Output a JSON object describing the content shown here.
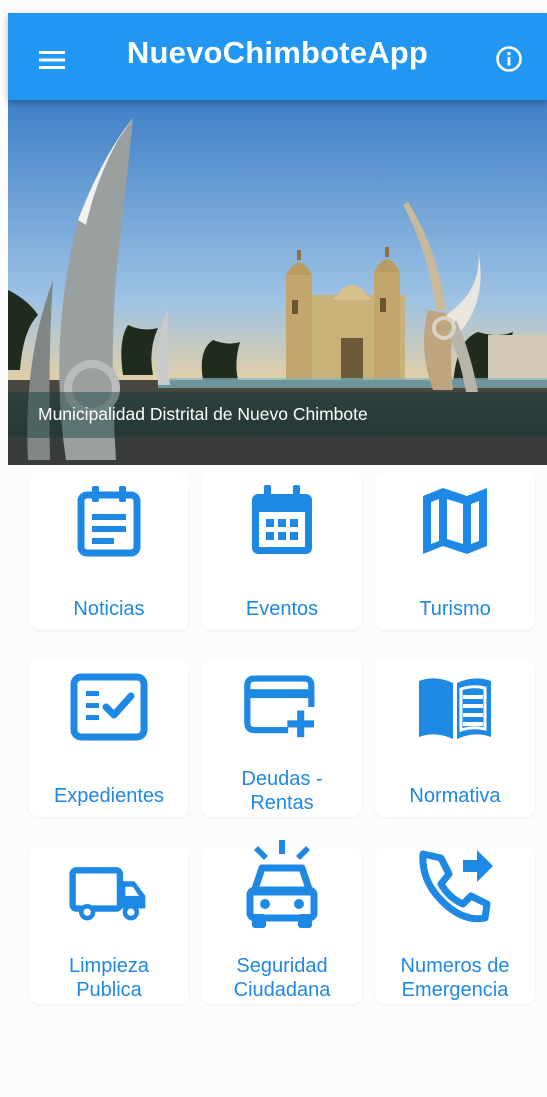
{
  "colors": {
    "primary": "#2196f3",
    "icon": "#1e88e5",
    "label": "#1e88e5"
  },
  "appbar": {
    "title": "NuevoChimboteApp",
    "menu_icon": "menu-icon",
    "info_icon": "info-icon"
  },
  "hero": {
    "caption": "Municipalidad Distrital de Nuevo Chimbote"
  },
  "menu": [
    {
      "id": "noticias",
      "icon": "news-icon",
      "label": "Noticias"
    },
    {
      "id": "eventos",
      "icon": "calendar-icon",
      "label": "Eventos"
    },
    {
      "id": "turismo",
      "icon": "map-icon",
      "label": "Turismo"
    },
    {
      "id": "expedientes",
      "icon": "checklist-icon",
      "label": "Expedientes"
    },
    {
      "id": "deudas",
      "icon": "credit-card-add-icon",
      "label": "Deudas -\nRentas"
    },
    {
      "id": "normativa",
      "icon": "book-icon",
      "label": "Normativa"
    },
    {
      "id": "limpieza",
      "icon": "truck-icon",
      "label": "Limpieza\nPublica"
    },
    {
      "id": "seguridad",
      "icon": "police-car-icon",
      "label": "Seguridad\nCiudadana"
    },
    {
      "id": "emergencia",
      "icon": "phone-forwarded-icon",
      "label": "Numeros de\nEmergencia"
    }
  ]
}
